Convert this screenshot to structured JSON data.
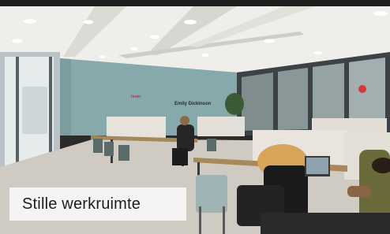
{
  "caption": {
    "text": "Stille werkruimte"
  },
  "wall_text": {
    "highlight": "brain",
    "author": "Emily Dickinson"
  }
}
